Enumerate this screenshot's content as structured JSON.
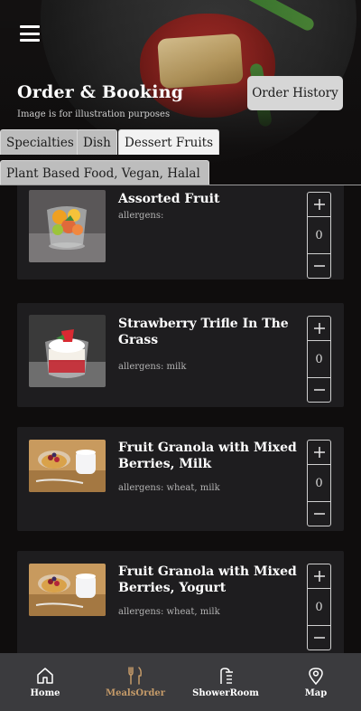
{
  "header": {
    "title": "Order & Booking",
    "note": "Image is for illustration purposes",
    "order_history_label": "Order History",
    "menu_icon": "hamburger-menu-icon"
  },
  "tabs": [
    {
      "label": "Specialties",
      "active": false
    },
    {
      "label": "Dish",
      "active": false
    },
    {
      "label": "Dessert Fruits",
      "active": true
    },
    {
      "label": "Plant Based Food, Vegan, Halal",
      "active": false
    }
  ],
  "items": [
    {
      "name": "Assorted Fruit",
      "allergens": "allergens:",
      "quantity": "0"
    },
    {
      "name": "Strawberry Trifle In The Grass",
      "allergens": "allergens: milk",
      "quantity": "0"
    },
    {
      "name": "Fruit Granola with Mixed Berries, Milk",
      "allergens": "allergens: wheat, milk",
      "quantity": "0"
    },
    {
      "name": "Fruit Granola with Mixed Berries, Yogurt",
      "allergens": "allergens: wheat, milk",
      "quantity": "0"
    }
  ],
  "nav": [
    {
      "label": "Home",
      "icon": "home-icon",
      "active": false
    },
    {
      "label": "MealsOrder",
      "icon": "fork-knife-icon",
      "active": true
    },
    {
      "label": "ShowerRoom",
      "icon": "shower-icon",
      "active": false
    },
    {
      "label": "Map",
      "icon": "map-pin-icon",
      "active": false
    }
  ],
  "colors": {
    "background": "#0f0d0d",
    "card": "#1e1d1f",
    "nav_bar": "#3b3b3e",
    "nav_active": "#c59b69",
    "tab_active": "#f2f2f2",
    "tab_inactive": "#bdbdbd"
  }
}
